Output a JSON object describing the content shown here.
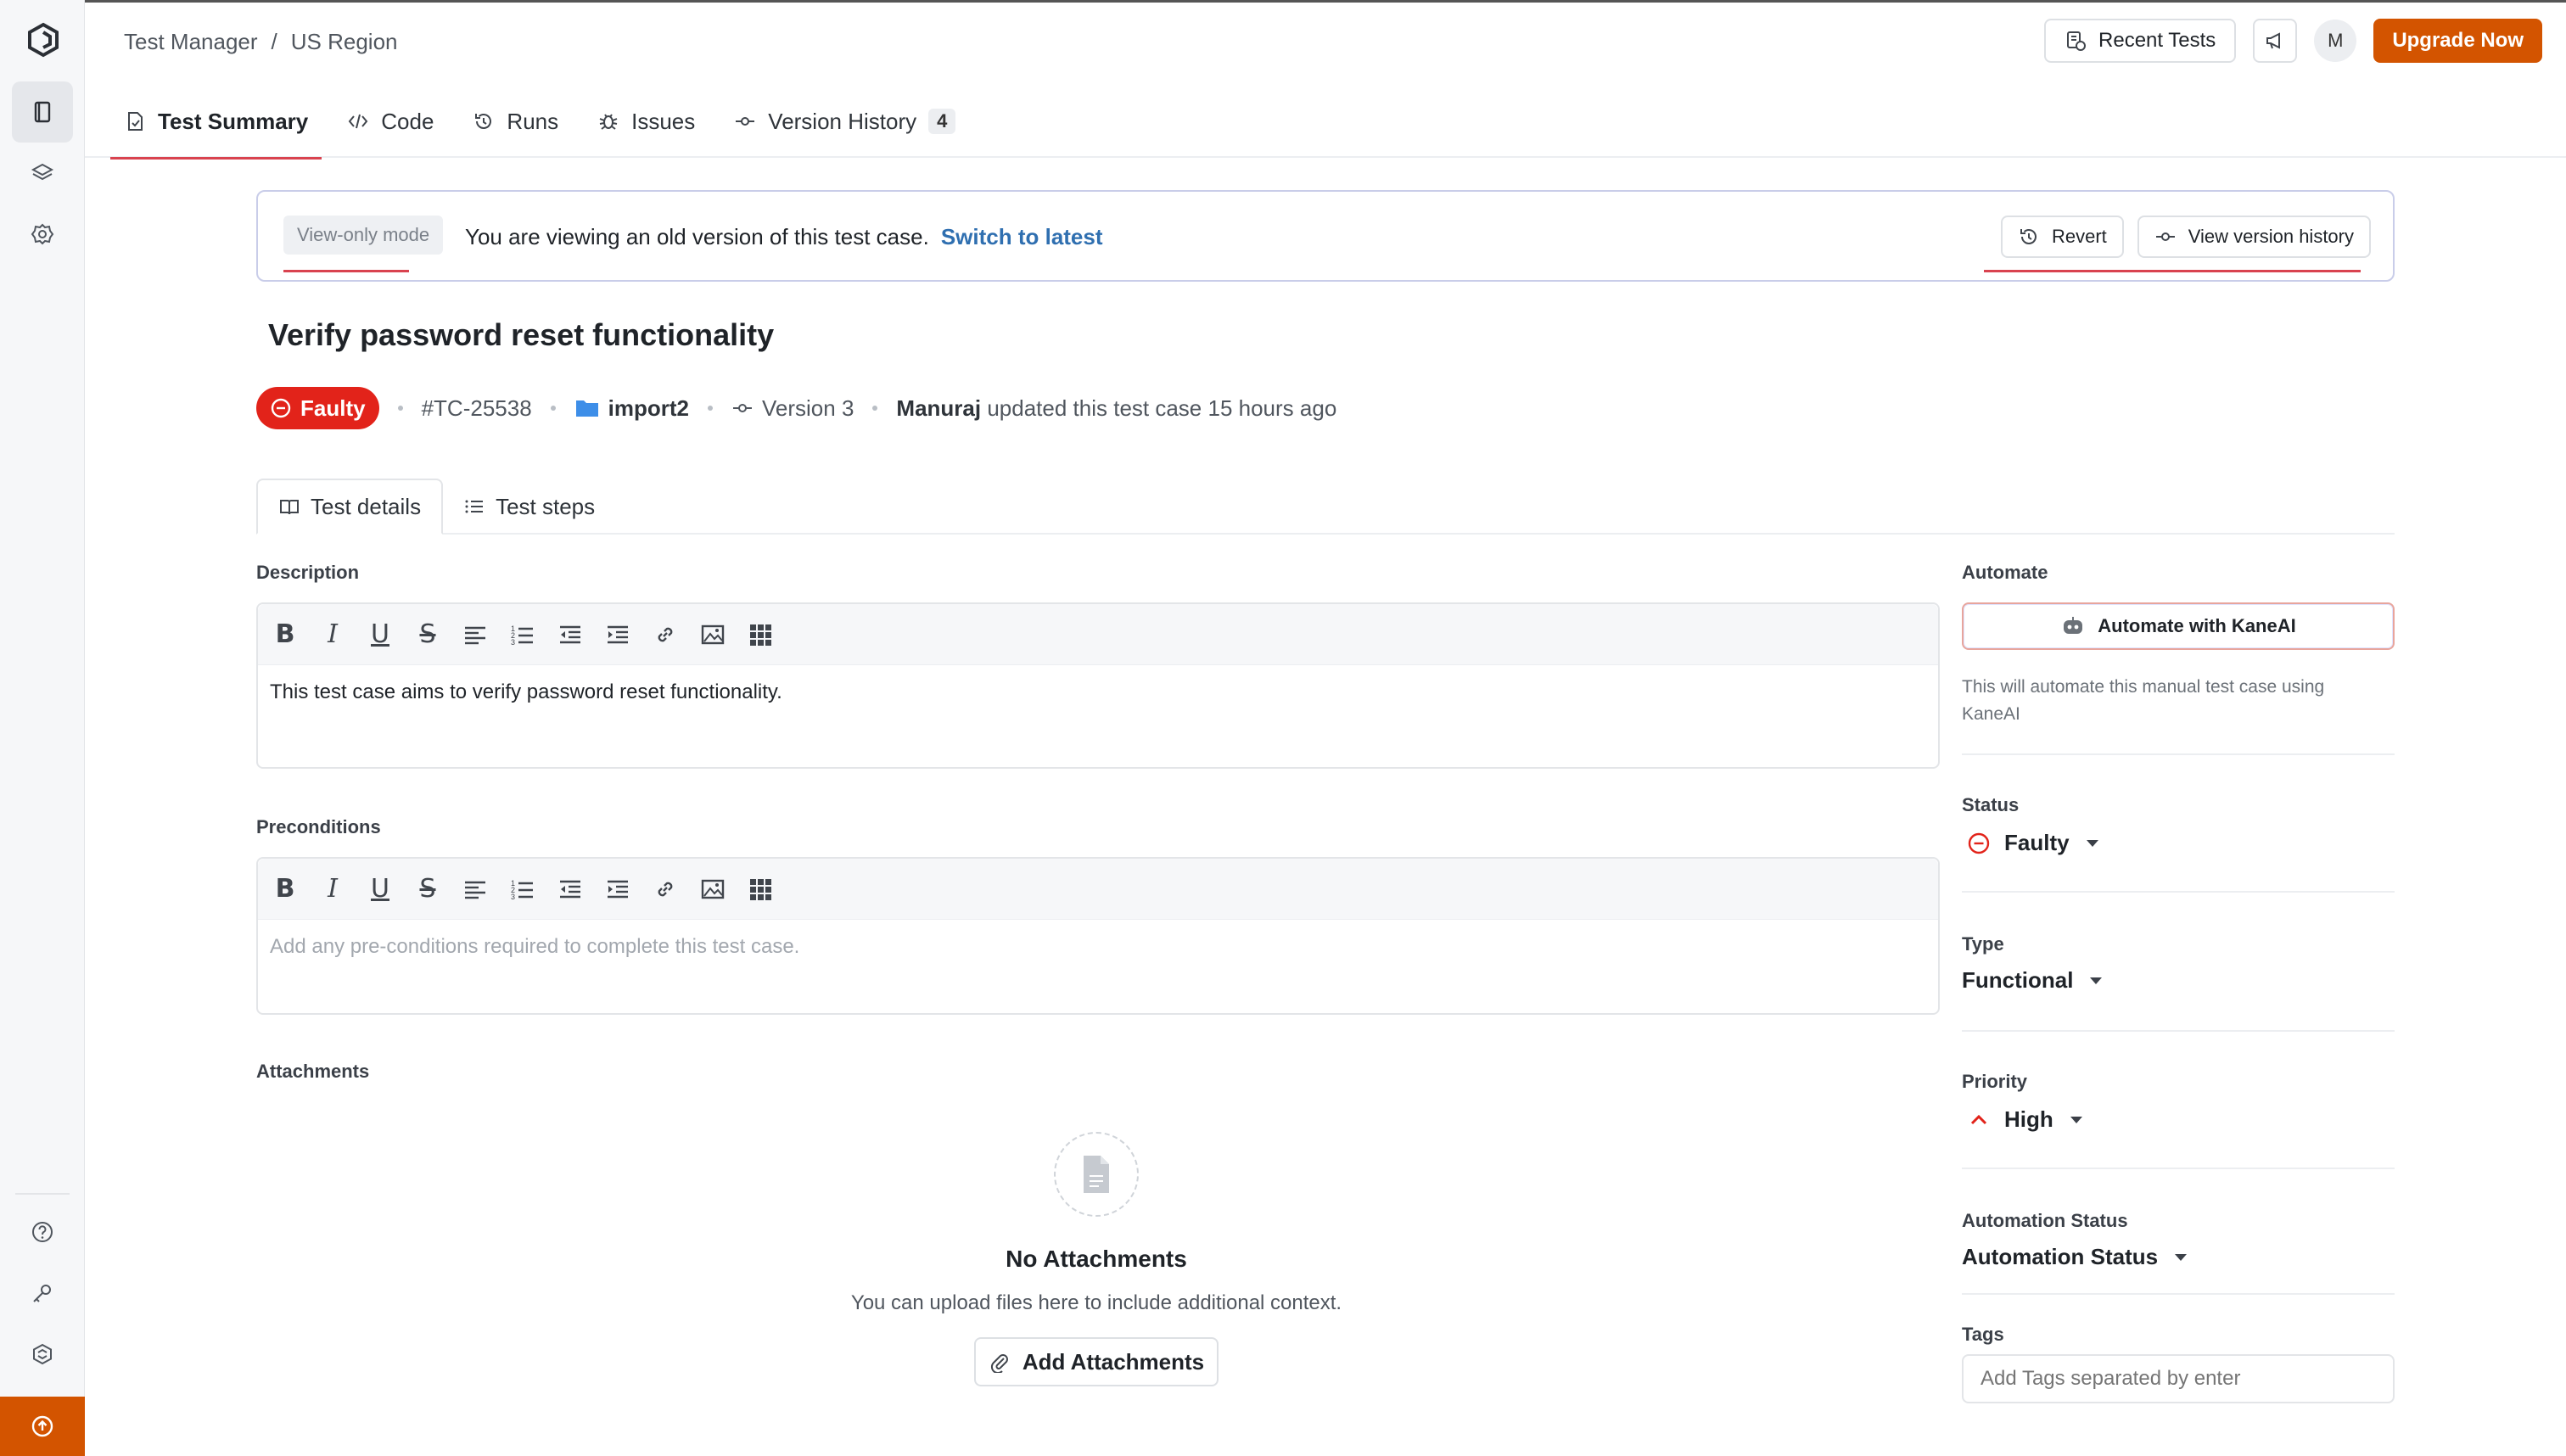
{
  "header": {
    "breadcrumb": [
      "Test Manager",
      "US Region"
    ],
    "breadcrumb_separator": "/",
    "recent_tests_label": "Recent Tests",
    "avatar_initial": "M",
    "upgrade_label": "Upgrade Now"
  },
  "tabs": [
    {
      "label": "Test Summary",
      "icon": "document-icon",
      "active": true
    },
    {
      "label": "Code",
      "icon": "code-icon"
    },
    {
      "label": "Runs",
      "icon": "history-icon"
    },
    {
      "label": "Issues",
      "icon": "bug-icon"
    },
    {
      "label": "Version History",
      "icon": "commit-icon",
      "count": "4"
    }
  ],
  "banner": {
    "mode_label": "View-only mode",
    "message": "You are viewing an old version of this test case.",
    "switch_label": "Switch to latest",
    "revert_label": "Revert",
    "view_history_label": "View version history"
  },
  "test_case": {
    "title": "Verify password reset functionality",
    "status_badge": "Faulty",
    "id": "#TC-25538",
    "folder": "import2",
    "version": "Version 3",
    "updater": "Manuraj",
    "updated_text": "updated this test case 15 hours ago"
  },
  "subtabs": [
    {
      "label": "Test details",
      "icon": "book-icon",
      "active": true
    },
    {
      "label": "Test steps",
      "icon": "list-icon"
    }
  ],
  "description": {
    "label": "Description",
    "text": "This test case aims to verify password reset functionality."
  },
  "preconditions": {
    "label": "Preconditions",
    "placeholder": "Add any pre-conditions required to complete this test case."
  },
  "attachments": {
    "label": "Attachments",
    "empty_title": "No Attachments",
    "empty_text": "You can upload files here to include additional context.",
    "add_label": "Add Attachments"
  },
  "right_panel": {
    "automate_label": "Automate",
    "automate_button": "Automate with KaneAI",
    "automate_hint": "This will automate this manual test case using KaneAI",
    "status_label": "Status",
    "status_value": "Faulty",
    "type_label": "Type",
    "type_value": "Functional",
    "priority_label": "Priority",
    "priority_value": "High",
    "automation_status_label": "Automation Status",
    "automation_status_value": "Automation Status",
    "tags_label": "Tags",
    "tags_placeholder": "Add Tags separated by enter"
  },
  "colors": {
    "accent": "#d35400",
    "danger": "#e2231a",
    "link": "#2f6fb0"
  }
}
